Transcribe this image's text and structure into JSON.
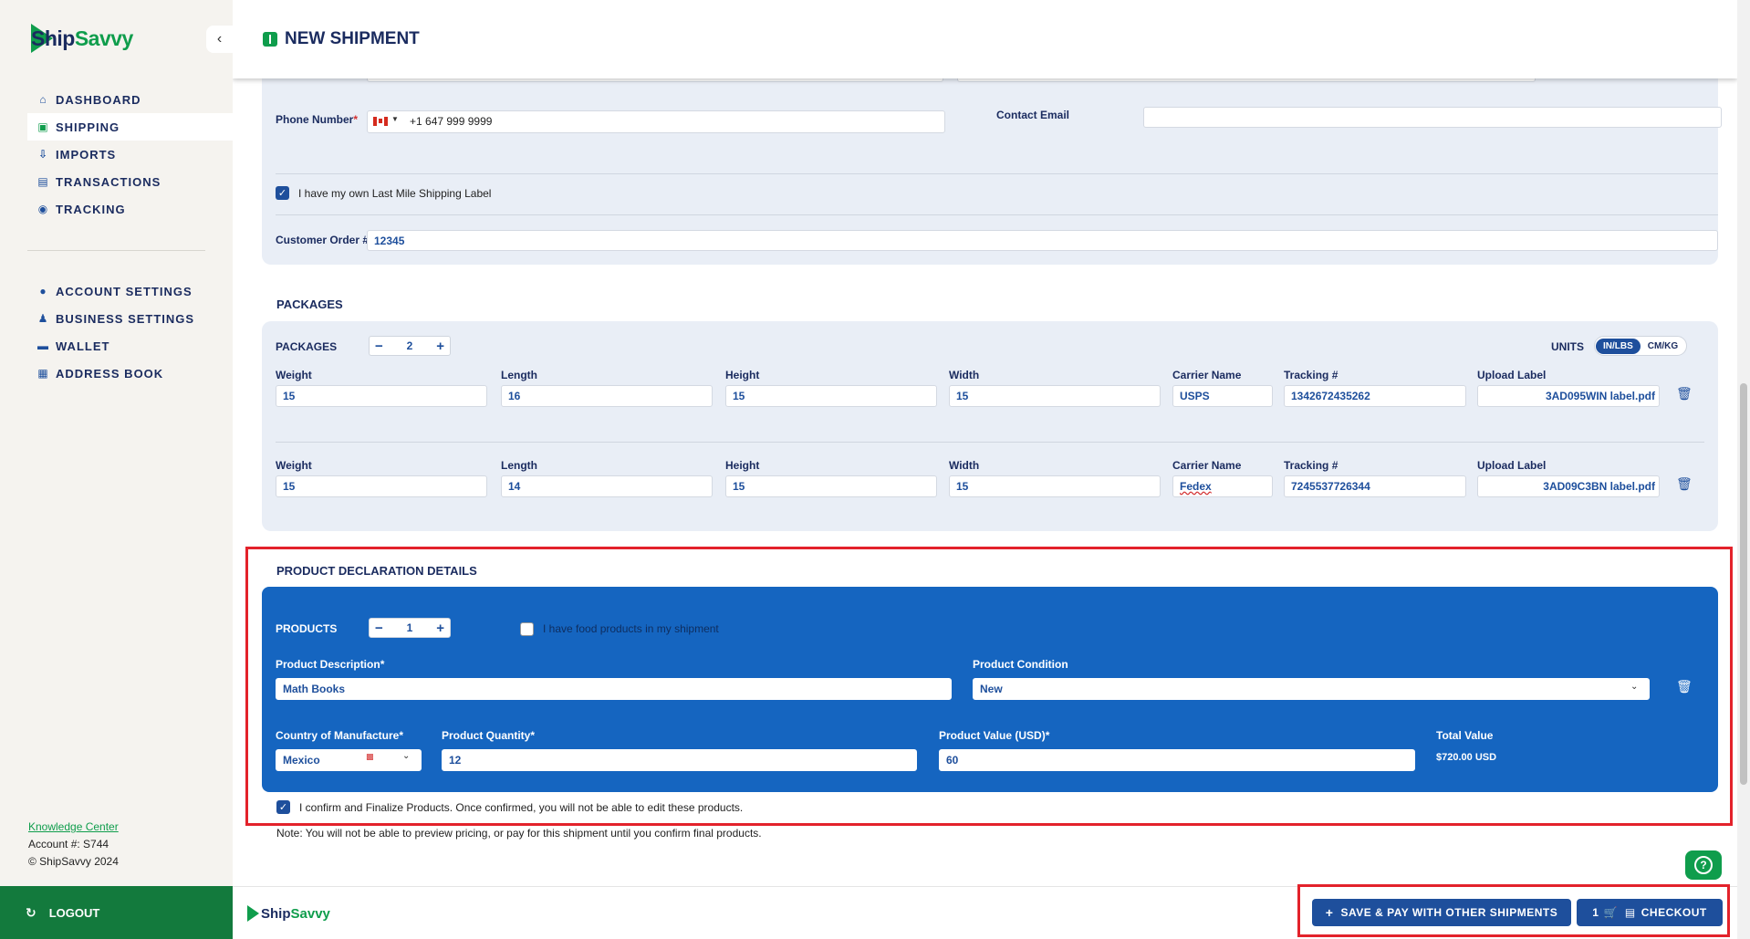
{
  "app": {
    "brand_part1": "Ship",
    "brand_part2": "Savvy",
    "page_title": "NEW SHIPMENT"
  },
  "sidebar": {
    "items": [
      {
        "label": "DASHBOARD",
        "icon": "home-icon"
      },
      {
        "label": "SHIPPING",
        "icon": "box-icon",
        "active": true
      },
      {
        "label": "IMPORTS",
        "icon": "import-icon"
      },
      {
        "label": "TRANSACTIONS",
        "icon": "document-icon"
      },
      {
        "label": "TRACKING",
        "icon": "tracking-icon"
      }
    ],
    "settings": [
      {
        "label": "ACCOUNT SETTINGS",
        "icon": "user-circle-icon"
      },
      {
        "label": "BUSINESS SETTINGS",
        "icon": "business-icon"
      },
      {
        "label": "WALLET",
        "icon": "wallet-icon"
      },
      {
        "label": "ADDRESS BOOK",
        "icon": "address-book-icon"
      }
    ],
    "knowledge_center": "Knowledge Center",
    "account": "Account #: S744",
    "copyright": "© ShipSavvy 2024",
    "logout": "LOGOUT"
  },
  "recipient": {
    "phone_label": "Phone Number",
    "phone_value": "+1 647 999 9999",
    "contact_email_label": "Contact Email",
    "contact_email_value": "",
    "last_mile_label": "I have my own Last Mile Shipping Label",
    "customer_order_label": "Customer Order #",
    "customer_order_value": "12345"
  },
  "packages": {
    "section_title": "PACKAGES",
    "count_label": "PACKAGES",
    "count": "2",
    "units_label": "UNITS",
    "units_options": [
      "IN/LBS",
      "CM/KG"
    ],
    "columns": [
      "Weight",
      "Length",
      "Height",
      "Width",
      "Carrier Name",
      "Tracking #",
      "Upload Label"
    ],
    "rows": [
      {
        "weight": "15",
        "length": "16",
        "height": "15",
        "width": "15",
        "carrier": "USPS",
        "tracking": "1342672435262",
        "label": "3AD095WIN label.pdf"
      },
      {
        "weight": "15",
        "length": "14",
        "height": "15",
        "width": "15",
        "carrier": "Fedex",
        "tracking": "7245537726344",
        "label": "3AD09C3BN label.pdf"
      }
    ]
  },
  "products": {
    "section_title": "PRODUCT DECLARATION DETAILS",
    "count_label": "PRODUCTS",
    "count": "1",
    "food_label": "I have food products in my shipment",
    "description_label": "Product Description",
    "description_value": "Math Books",
    "condition_label": "Product Condition",
    "condition_value": "New",
    "country_label": "Country of Manufacture",
    "country_value": "Mexico",
    "quantity_label": "Product Quantity",
    "quantity_value": "12",
    "value_label": "Product Value (USD)",
    "value_value": "60",
    "total_label": "Total Value",
    "total_value": "$720.00 USD",
    "confirm_label": "I confirm and Finalize Products. Once confirmed, you will not be able to edit these products.",
    "note": "Note: You will not be able to preview pricing, or pay for this shipment until you confirm final products."
  },
  "footer": {
    "save_pay_label": "SAVE & PAY WITH OTHER SHIPMENTS",
    "cart_count": "1",
    "checkout_label": "CHECKOUT"
  },
  "colors": {
    "brand_green": "#0f9d4c",
    "brand_navy": "#1a2b5f",
    "accent_blue": "#1e4f9c",
    "product_panel": "#1565c0",
    "highlight_red": "#e3222b"
  }
}
